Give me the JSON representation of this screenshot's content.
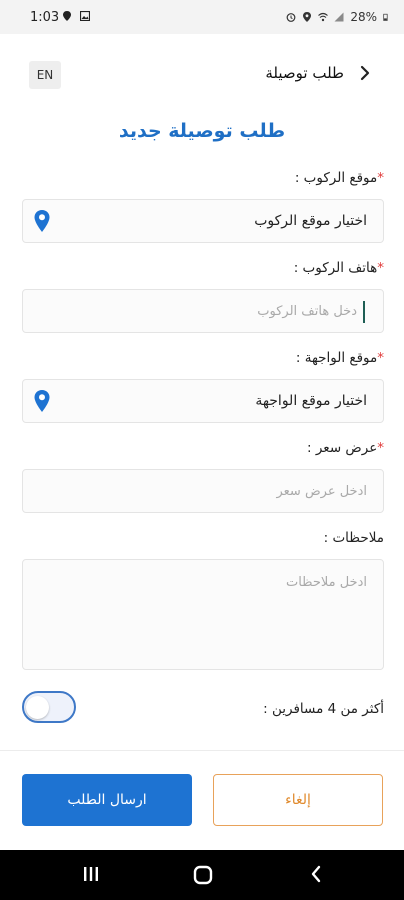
{
  "status_bar": {
    "time": "1:03",
    "battery": "28%"
  },
  "header": {
    "title": "طلب توصيلة",
    "lang_button": "EN"
  },
  "page_title": "طلب توصيلة جديد",
  "form": {
    "pickup_location": {
      "label": "موقع الركوب :",
      "required": "*",
      "value": "اختيار موقع الركوب"
    },
    "pickup_phone": {
      "label": "هاتف الركوب :",
      "required": "*",
      "placeholder": "دخل هاتف الركوب"
    },
    "destination": {
      "label": "موقع الواجهة :",
      "required": "*",
      "value": "اختيار موقع الواجهة"
    },
    "price_offer": {
      "label": "عرض سعر :",
      "required": "*",
      "placeholder": "ادخل  عرض سعر"
    },
    "notes": {
      "label": "ملاحظات :",
      "placeholder": "ادخل ملاحظات"
    },
    "more_passengers": {
      "label": "أكثر من 4 مسافرين :",
      "enabled": false
    }
  },
  "buttons": {
    "submit": "ارسال الطلب",
    "cancel": "إلغاء"
  },
  "colors": {
    "accent": "#1e73d2",
    "title": "#1f6fc5",
    "cancel": "#e08a2d",
    "required": "#e03a3a"
  }
}
